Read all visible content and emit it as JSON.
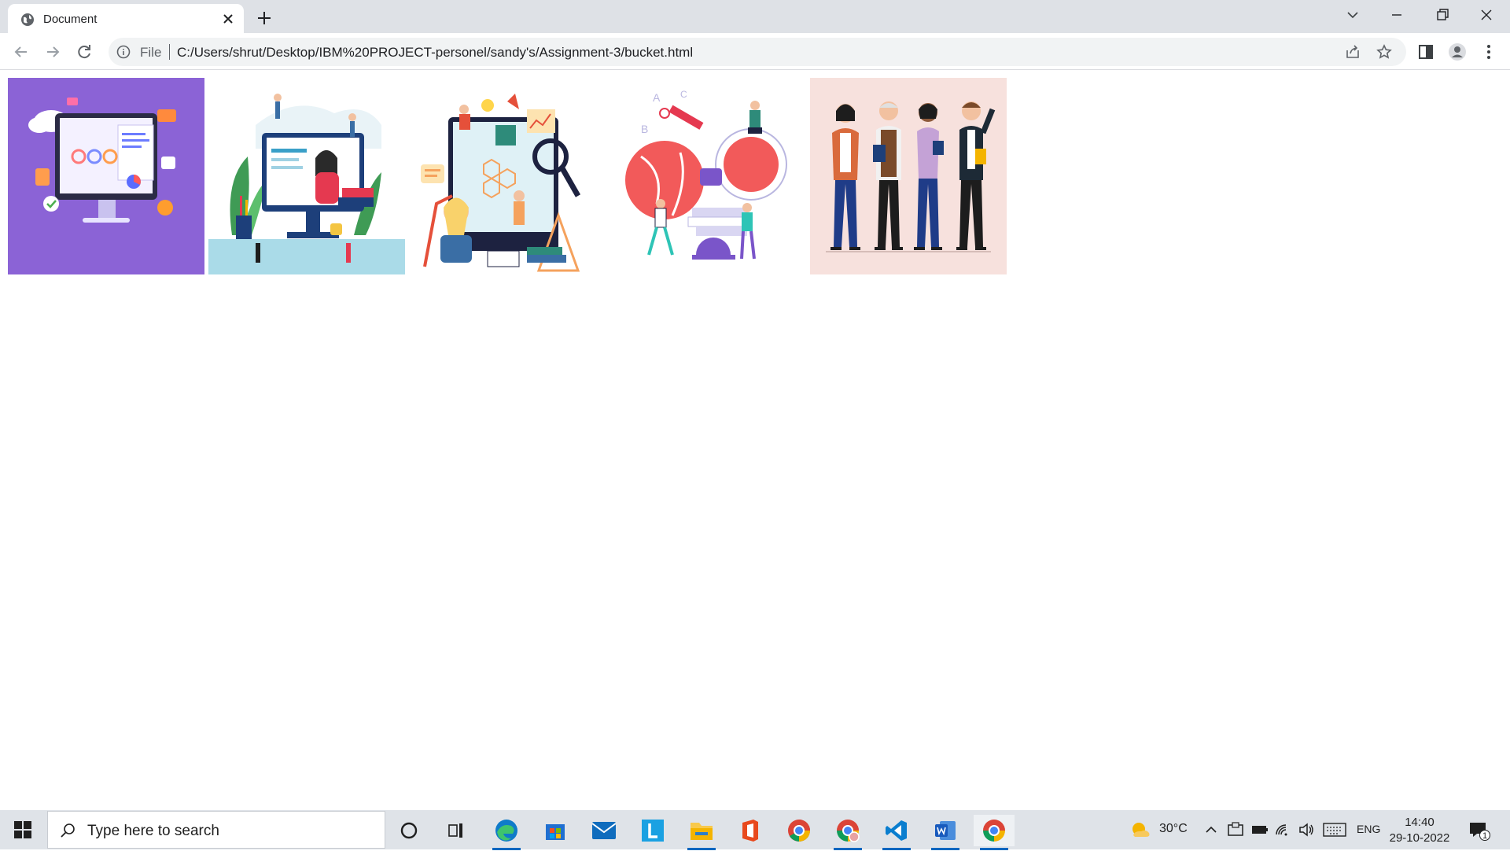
{
  "browser": {
    "tab_title": "Document",
    "address_scheme": "File",
    "address_url": "C:/Users/shrut/Desktop/IBM%20PROJECT-personel/sandy's/Assignment-3/bucket.html"
  },
  "page": {
    "images": [
      {
        "subject": "computer monitor with code windows on purple background",
        "background": "#8b63d6"
      },
      {
        "subject": "woman on computer screen with plants and books",
        "background": "#ffffff"
      },
      {
        "subject": "science learning scene with monitor, magnifier and people",
        "background": "#ffffff"
      },
      {
        "subject": "students with globe, books and letters",
        "background": "#ffffff"
      },
      {
        "subject": "group of four teachers standing",
        "background": "#f7e1dd"
      }
    ]
  },
  "taskbar": {
    "search_placeholder": "Type here to search",
    "apps": [
      "cortana",
      "task-view",
      "edge",
      "store",
      "mail",
      "l-app",
      "file-explorer",
      "office",
      "chrome",
      "chrome-profile",
      "vscode",
      "word",
      "chrome-active"
    ],
    "weather_temp": "30°C",
    "language": "ENG",
    "time": "14:40",
    "date": "29-10-2022",
    "notification_count": "1"
  },
  "colors": {
    "tabstrip": "#dee1e6",
    "omnibox": "#f1f3f4",
    "taskbar": "#dfe3e8"
  }
}
